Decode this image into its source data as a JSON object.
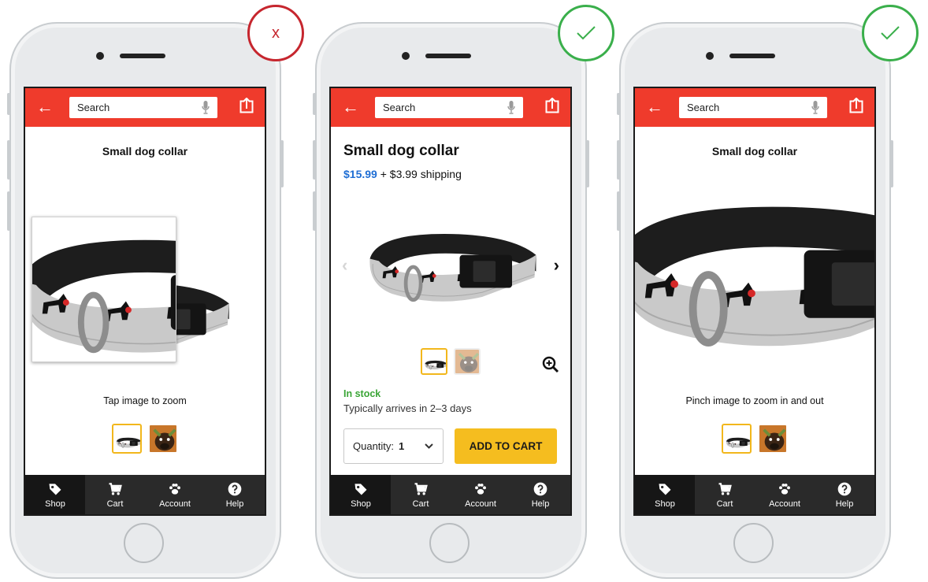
{
  "colors": {
    "brand_red": "#ef3b2c",
    "price_blue": "#1f6ed4",
    "stock_green": "#3aa536",
    "cta_yellow": "#f5bd1f",
    "bad_red": "#c6262e",
    "good_green": "#3aaf4b"
  },
  "shared": {
    "back_icon": "arrow-left-icon",
    "search_placeholder": "Search",
    "tabs": [
      {
        "label": "Shop",
        "icon": "tag-icon"
      },
      {
        "label": "Cart",
        "icon": "cart-icon"
      },
      {
        "label": "Account",
        "icon": "paw-icon"
      },
      {
        "label": "Help",
        "icon": "question-icon"
      }
    ]
  },
  "phone1": {
    "badge": "x",
    "title": "Small dog collar",
    "caption": "Tap image to zoom"
  },
  "phone2": {
    "badge": "check",
    "title": "Small dog collar",
    "price": "$15.99",
    "shipping": " + $3.99 shipping",
    "stock": "In stock",
    "arrives": "Typically arrives in 2–3 days",
    "quantity_label": "Quantity:",
    "quantity_value": "1",
    "add_to_cart": "ADD TO CART"
  },
  "phone3": {
    "badge": "check",
    "title": "Small dog collar",
    "caption": "Pinch image to zoom in and out"
  }
}
